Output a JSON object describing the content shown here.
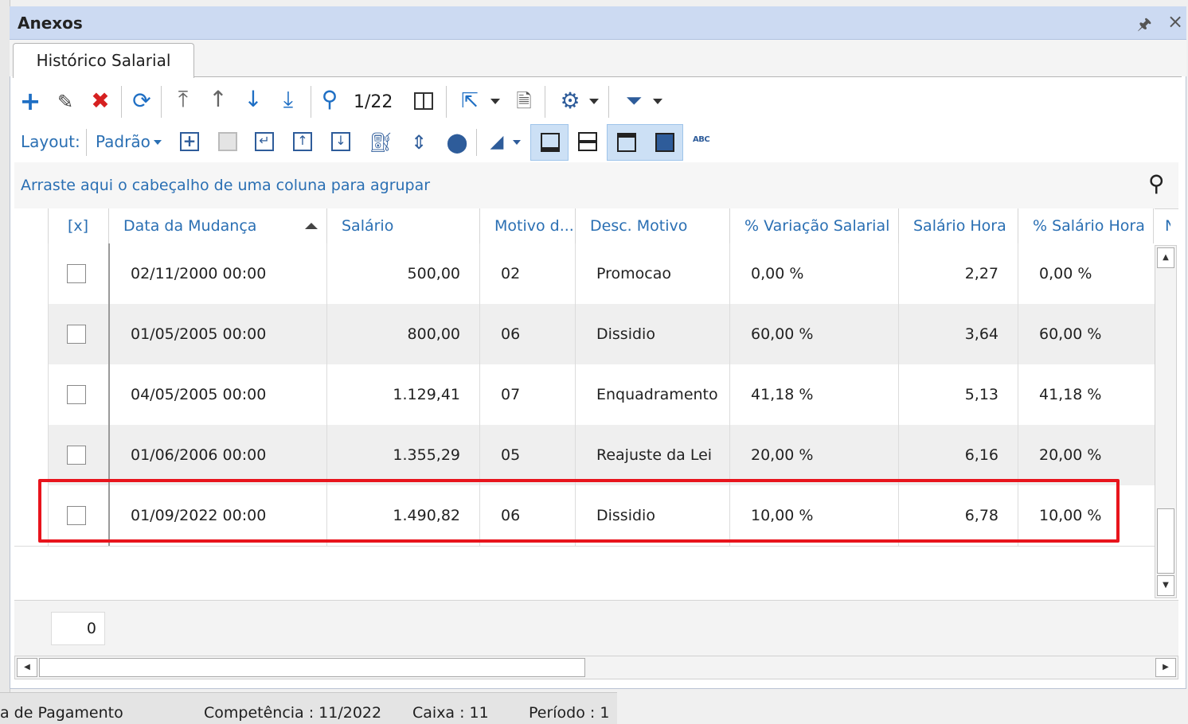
{
  "panel": {
    "title": "Anexos"
  },
  "tabs": [
    {
      "label": "Histórico Salarial"
    }
  ],
  "toolbar": {
    "record_counter": "1/22"
  },
  "layout_bar": {
    "label": "Layout:",
    "value": "Padrão",
    "abc_label": "ABC"
  },
  "group_area": {
    "hint": "Arraste aqui o cabeçalho de uma coluna para agrupar"
  },
  "grid": {
    "columns": [
      "[x]",
      "Data da Mudança",
      "Salário",
      "Motivo d...",
      "Desc. Motivo",
      "% Variação Salarial",
      "Salário Hora",
      "% Salário Hora",
      "N"
    ],
    "rows": [
      {
        "date": "02/11/2000 00:00",
        "salary": "500,00",
        "code": "02",
        "reason": "Promocao",
        "variation": "0,00 %",
        "hourly": "2,27",
        "hourly_pct": "0,00 %"
      },
      {
        "date": "01/05/2005 00:00",
        "salary": "800,00",
        "code": "06",
        "reason": "Dissidio",
        "variation": "60,00 %",
        "hourly": "3,64",
        "hourly_pct": "60,00 %"
      },
      {
        "date": "04/05/2005 00:00",
        "salary": "1.129,41",
        "code": "07",
        "reason": "Enquadramento",
        "variation": "41,18 %",
        "hourly": "5,13",
        "hourly_pct": "41,18 %"
      },
      {
        "date": "01/06/2006 00:00",
        "salary": "1.355,29",
        "code": "05",
        "reason": "Reajuste da Lei",
        "variation": "20,00 %",
        "hourly": "6,16",
        "hourly_pct": "20,00 %"
      },
      {
        "date": "01/09/2022 00:00",
        "salary": "1.490,82",
        "code": "06",
        "reason": "Dissidio",
        "variation": "10,00 %",
        "hourly": "6,78",
        "hourly_pct": "10,00 %"
      }
    ],
    "footer_count": "0"
  },
  "statusbar": {
    "items": [
      "a de Pagamento",
      "Competência : 11/2022",
      "Caixa : 11",
      "Período : 1"
    ]
  },
  "colors": {
    "accent": "#2a6fb3",
    "highlight_box": "#e8141c",
    "titlebar": "#ccdaf2"
  }
}
